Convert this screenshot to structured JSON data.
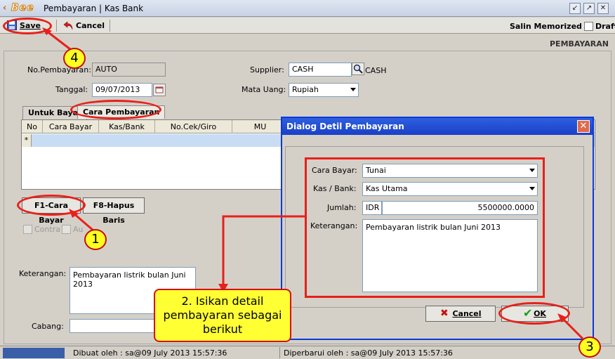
{
  "window": {
    "app_logo": "Bee",
    "title": "Pembayaran | Kas Bank"
  },
  "toolbar": {
    "save_label": "Save",
    "cancel_label": "Cancel",
    "salin_label": "Salin Memorized",
    "draft_label": "Draft"
  },
  "form": {
    "section_title": "PEMBAYARAN",
    "no_label": "No.Pembayaran:",
    "no_value": "AUTO",
    "tanggal_label": "Tanggal:",
    "tanggal_value": "09/07/2013",
    "supplier_label": "Supplier:",
    "supplier_value": "CASH",
    "supplier_name": "CASH",
    "mata_uang_label": "Mata Uang:",
    "mata_uang_value": "Rupiah",
    "tabs": [
      "Untuk Bayar",
      "Cara Pembayaran"
    ],
    "grid_columns": [
      "No",
      "Cara Bayar",
      "Kas/Bank",
      "No.Cek/Giro",
      "MU"
    ],
    "grid_new_row_marker": "*",
    "f1_button": "F1-Cara Bayar",
    "f8_button": "F8-Hapus Baris",
    "contra_label": "Contra",
    "auto_label": "Au",
    "keterangan_label": "Keterangan:",
    "keterangan_value": "Pembayaran listrik bulan Juni 2013",
    "cabang_label": "Cabang:"
  },
  "status": {
    "dibuat": "Dibuat oleh : sa@09 July 2013  15:57:36",
    "diperbarui": "Diperbarui oleh : sa@09 July 2013  15:57:36"
  },
  "dialog": {
    "title": "Dialog Detil Pembayaran",
    "close_glyph": "✕",
    "cara_bayar_label": "Cara Bayar:",
    "cara_bayar_value": "Tunai",
    "kas_bank_label": "Kas / Bank:",
    "kas_bank_value": "Kas Utama",
    "jumlah_label": "Jumlah:",
    "jumlah_currency": "IDR",
    "jumlah_value": "5500000.0000",
    "keterangan_label": "Keterangan:",
    "keterangan_value": "Pembayaran listrik bulan Juni 2013",
    "cancel_button": "Cancel",
    "ok_button": "OK"
  },
  "annotations": {
    "callout_1": "1",
    "callout_3": "3",
    "callout_4": "4",
    "instruction": "2. Isikan detail pembayaran sebagai berikut"
  },
  "colors": {
    "annotation_red": "#e8201a",
    "callout_yellow": "#ffff33",
    "dialog_blue": "#0a3ad8"
  }
}
